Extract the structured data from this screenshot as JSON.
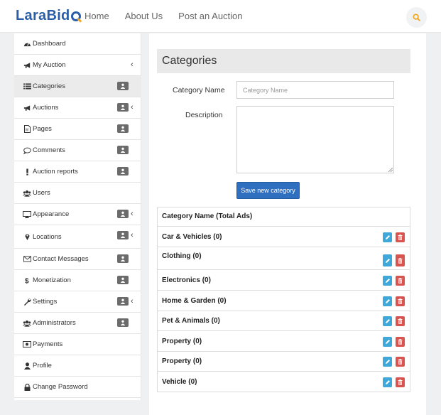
{
  "header": {
    "logo_main": "LaraBid",
    "nav": [
      "Home",
      "About Us",
      "Post an Auction"
    ]
  },
  "sidebar": {
    "items": [
      {
        "label": "Dashboard",
        "icon": "dashboard-icon",
        "badge": false,
        "chevron": false,
        "active": false
      },
      {
        "label": "My Auction",
        "icon": "bullhorn-icon",
        "badge": false,
        "chevron": true,
        "active": false
      },
      {
        "label": "Categories",
        "icon": "list-icon",
        "badge": true,
        "chevron": false,
        "active": true
      },
      {
        "label": "Auctions",
        "icon": "bullhorn-icon",
        "badge": true,
        "chevron": true,
        "active": false
      },
      {
        "label": "Pages",
        "icon": "file-icon",
        "badge": true,
        "chevron": false,
        "active": false
      },
      {
        "label": "Comments",
        "icon": "comment-icon",
        "badge": true,
        "chevron": false,
        "active": false
      },
      {
        "label": "Auction reports",
        "icon": "exclamation-icon",
        "badge": true,
        "chevron": false,
        "active": false
      },
      {
        "label": "Users",
        "icon": "users-icon",
        "badge": false,
        "chevron": false,
        "active": false
      },
      {
        "label": "Appearance",
        "icon": "desktop-icon",
        "badge": true,
        "chevron": true,
        "active": false
      },
      {
        "label": "Locations",
        "icon": "map-marker-icon",
        "badge": true,
        "chevron": true,
        "active": false
      },
      {
        "label": "Contact Messages",
        "icon": "envelope-icon",
        "badge": true,
        "chevron": false,
        "active": false
      },
      {
        "label": "Monetization",
        "icon": "dollar-icon",
        "badge": true,
        "chevron": false,
        "active": false
      },
      {
        "label": "Settings",
        "icon": "wrench-icon",
        "badge": true,
        "chevron": true,
        "active": false
      },
      {
        "label": "Administrators",
        "icon": "users-icon",
        "badge": true,
        "chevron": false,
        "active": false
      },
      {
        "label": "Payments",
        "icon": "money-icon",
        "badge": false,
        "chevron": false,
        "active": false
      },
      {
        "label": "Profile",
        "icon": "user-icon",
        "badge": false,
        "chevron": false,
        "active": false
      },
      {
        "label": "Change Password",
        "icon": "lock-icon",
        "badge": false,
        "chevron": false,
        "active": false
      }
    ]
  },
  "main": {
    "title": "Categories",
    "form": {
      "name_label": "Category Name",
      "name_placeholder": "Category Name",
      "name_value": "",
      "desc_label": "Description",
      "desc_value": "",
      "submit_label": "Save new category"
    },
    "table": {
      "header": "Category Name (Total Ads)",
      "rows": [
        "Car & Vehicles (0)",
        "Clothing (0)",
        "Electronics (0)",
        "Home & Garden (0)",
        "Pet & Animals (0)",
        "Property (0)",
        "Property (0)",
        "Vehicle (0)"
      ]
    }
  },
  "colors": {
    "brand_blue": "#2b5ea8",
    "brand_orange": "#f2a51f",
    "primary_button": "#2f6fbf",
    "edit_button": "#3fa8d8",
    "delete_button": "#d9534f"
  }
}
